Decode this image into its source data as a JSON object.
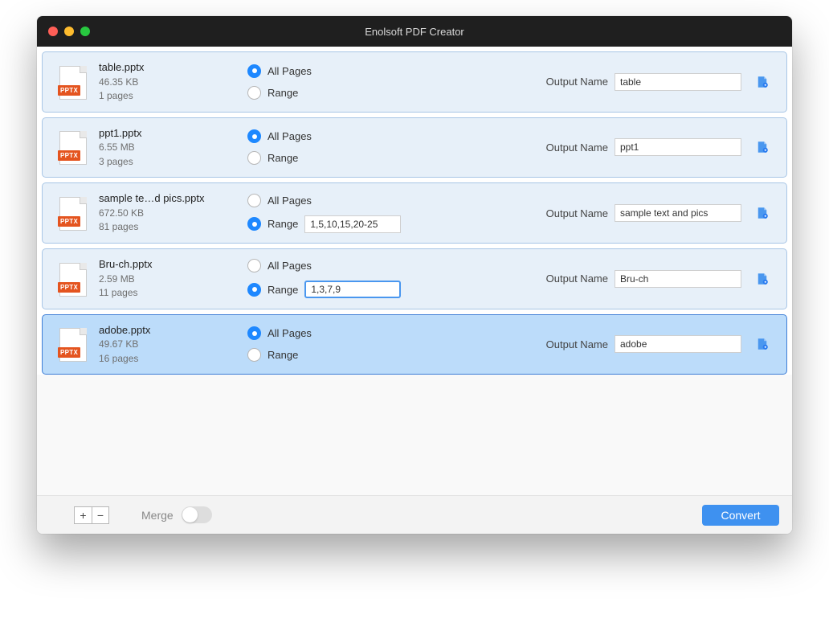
{
  "window": {
    "title": "Enolsoft PDF Creator"
  },
  "labels": {
    "all_pages": "All Pages",
    "range": "Range",
    "output_name": "Output Name",
    "merge": "Merge",
    "convert": "Convert",
    "file_badge": "PPTX"
  },
  "files": [
    {
      "name": "table.pptx",
      "size": "46.35 KB",
      "pages": "1 pages",
      "mode": "all",
      "range": "",
      "output": "table",
      "selected": false,
      "range_focused": false
    },
    {
      "name": "ppt1.pptx",
      "size": "6.55 MB",
      "pages": "3 pages",
      "mode": "all",
      "range": "",
      "output": "ppt1",
      "selected": false,
      "range_focused": false
    },
    {
      "name": "sample te…d pics.pptx",
      "size": "672.50 KB",
      "pages": "81 pages",
      "mode": "range",
      "range": "1,5,10,15,20-25",
      "output": "sample text and pics",
      "selected": false,
      "range_focused": false
    },
    {
      "name": "Bru-ch.pptx",
      "size": "2.59 MB",
      "pages": "11 pages",
      "mode": "range",
      "range": "1,3,7,9",
      "output": "Bru-ch",
      "selected": false,
      "range_focused": true
    },
    {
      "name": "adobe.pptx",
      "size": "49.67 KB",
      "pages": "16 pages",
      "mode": "all",
      "range": "",
      "output": "adobe",
      "selected": true,
      "range_focused": false
    }
  ]
}
